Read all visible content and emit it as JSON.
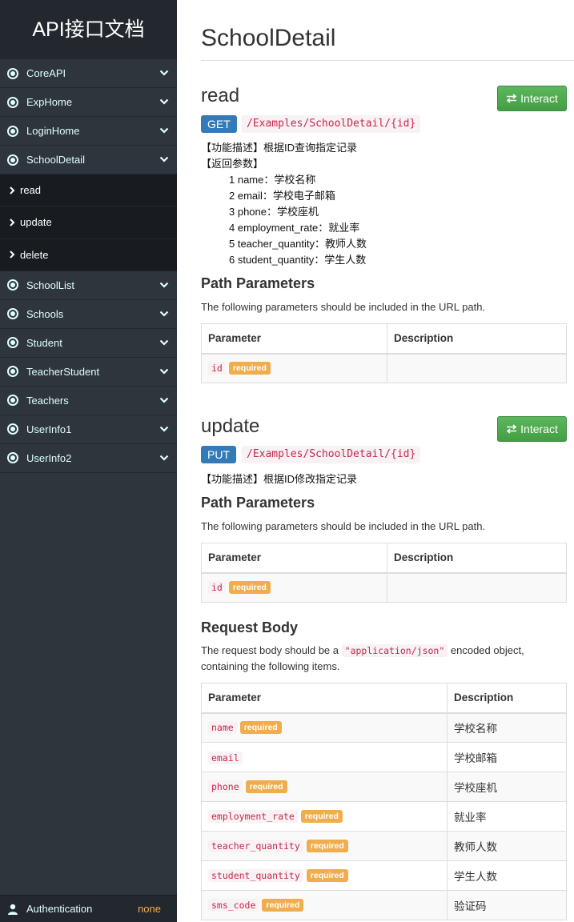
{
  "sidebar": {
    "brand": "API接口文档",
    "groups_top": [
      {
        "label": "CoreAPI"
      },
      {
        "label": "ExpHome"
      },
      {
        "label": "LoginHome"
      },
      {
        "label": "SchoolDetail"
      }
    ],
    "sub_items": [
      {
        "label": "read"
      },
      {
        "label": "update"
      },
      {
        "label": "delete"
      }
    ],
    "groups_bottom": [
      {
        "label": "SchoolList"
      },
      {
        "label": "Schools"
      },
      {
        "label": "Student"
      },
      {
        "label": "TeacherStudent"
      },
      {
        "label": "Teachers"
      },
      {
        "label": "UserInfo1"
      },
      {
        "label": "UserInfo2"
      }
    ],
    "auth": {
      "label": "Authentication",
      "value": "none"
    }
  },
  "main": {
    "title": "SchoolDetail",
    "read": {
      "name": "read",
      "interact_label": "Interact",
      "method": "GET",
      "path": "/Examples/SchoolDetail/{id}",
      "desc_lines": [
        "【功能描述】根据ID查询指定记录",
        "【返回参数】"
      ],
      "return_lines": [
        "1 name：学校名称",
        "2 email：学校电子邮箱",
        "3 phone：学校座机",
        "4 employment_rate：就业率",
        "5 teacher_quantity：教师人数",
        "6 student_quantity：学生人数"
      ],
      "path_params_title": "Path Parameters",
      "path_params_text": "The following parameters should be included in the URL path.",
      "table_headers": [
        "Parameter",
        "Description"
      ],
      "params": [
        {
          "name": "id",
          "badge": "required",
          "desc": ""
        }
      ]
    },
    "update": {
      "name": "update",
      "interact_label": "Interact",
      "method": "PUT",
      "path": "/Examples/SchoolDetail/{id}",
      "desc_lines": [
        "【功能描述】根据ID修改指定记录"
      ],
      "path_params_title": "Path Parameters",
      "path_params_text": "The following parameters should be included in the URL path.",
      "table_headers": [
        "Parameter",
        "Description"
      ],
      "params": [
        {
          "name": "id",
          "badge": "required",
          "desc": ""
        }
      ],
      "body_title": "Request Body",
      "body_text_pre": "The request body should be a",
      "body_code": "\"application/json\"",
      "body_text_post": "encoded object, containing the following items.",
      "body_headers": [
        "Parameter",
        "Description"
      ],
      "body_params": [
        {
          "name": "name",
          "badge": "required",
          "desc": "学校名称"
        },
        {
          "name": "email",
          "badge": "",
          "desc": "学校邮箱"
        },
        {
          "name": "phone",
          "badge": "required",
          "desc": "学校座机"
        },
        {
          "name": "employment_rate",
          "badge": "required",
          "desc": "就业率"
        },
        {
          "name": "teacher_quantity",
          "badge": "required",
          "desc": "教师人数"
        },
        {
          "name": "student_quantity",
          "badge": "required",
          "desc": "学生人数"
        },
        {
          "name": "sms_code",
          "badge": "required",
          "desc": "验证码"
        }
      ]
    }
  },
  "colors": {
    "sidebar_bg": "#2e353d",
    "sidebar_sub_bg": "#181c20",
    "method_badge": "#337ab7",
    "interact_button": "#5cb85c",
    "required_badge": "#f0ad4e",
    "code_text": "#c7254e"
  },
  "icons": {
    "menu_bullet": "circle-dot-icon",
    "menu_chevron": "chevron-down-icon",
    "sub_arrow": "chevron-right-icon",
    "interact": "exchange-arrows-icon",
    "auth": "user-icon"
  }
}
